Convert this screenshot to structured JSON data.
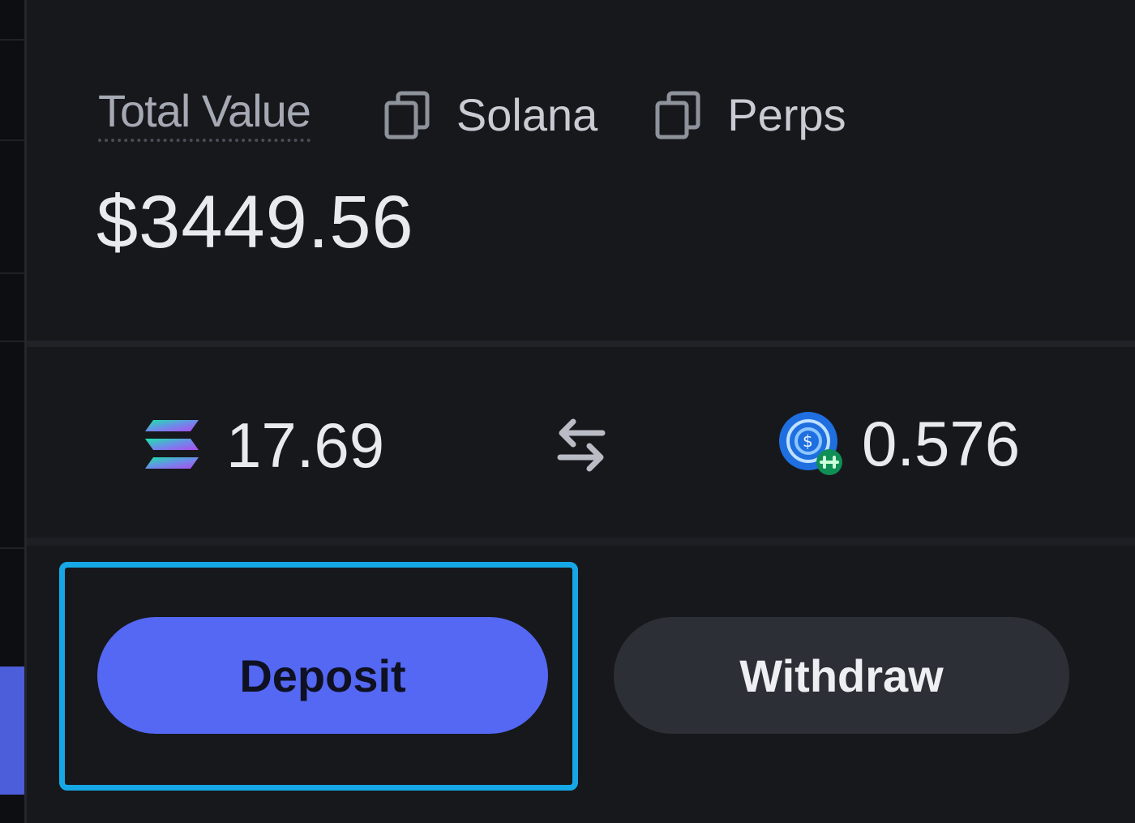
{
  "header": {
    "total_label": "Total Value",
    "total_value": "$3449.56",
    "links": [
      {
        "label": "Solana",
        "icon": "copy-icon"
      },
      {
        "label": "Perps",
        "icon": "copy-icon"
      }
    ]
  },
  "balances": {
    "sol_amount": "17.69",
    "sol_icon": "solana-logo-icon",
    "swap_icon": "swap-arrows-icon",
    "perps_amount": "0.576",
    "perps_icon": "perps-token-icon"
  },
  "actions": {
    "deposit_label": "Deposit",
    "withdraw_label": "Withdraw"
  },
  "colors": {
    "accent": "#5468f4",
    "focus_ring": "#16a8e6",
    "background": "#17181c",
    "secondary_button": "#2d2f36"
  }
}
